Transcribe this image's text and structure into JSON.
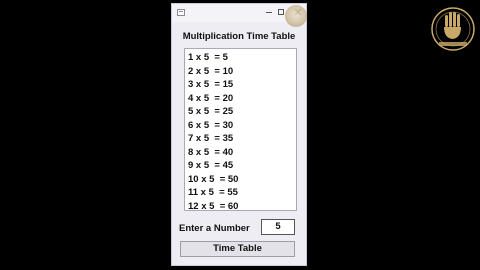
{
  "app": {
    "heading": "Multiplication Time Table"
  },
  "table_rows": [
    "1 x 5  = 5",
    "2 x 5  = 10",
    "3 x 5  = 15",
    "4 x 5  = 20",
    "5 x 5  = 25",
    "6 x 5  = 30",
    "7 x 5  = 35",
    "8 x 5  = 40",
    "9 x 5  = 45",
    "10 x 5  = 50",
    "11 x 5  = 55",
    "12 x 5  = 60"
  ],
  "input": {
    "label": "Enter a Number",
    "value": "5"
  },
  "button": {
    "label": "Time Table"
  },
  "window_controls": {
    "close_glyph": "✕"
  },
  "icons": {
    "app": "window-app-icon",
    "logo": "hand-emblem-logo"
  },
  "colors": {
    "background": "#000000",
    "window": "#ededf3",
    "logo_gold": "#c9a96a"
  }
}
